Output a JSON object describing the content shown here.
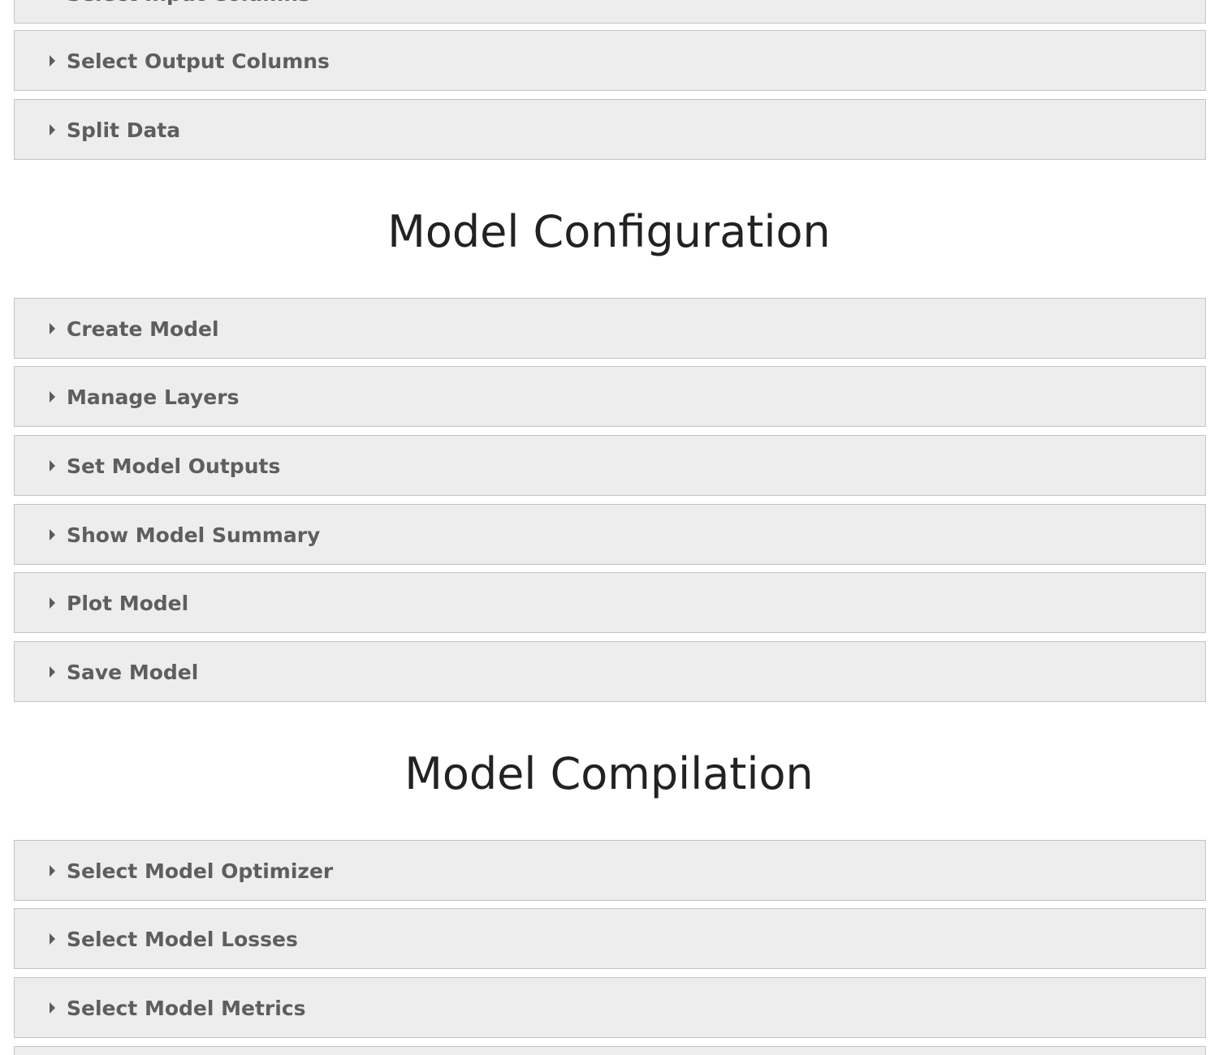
{
  "sections": {
    "data_prep": {
      "panels": [
        {
          "label": "Select Input Columns"
        },
        {
          "label": "Select Output Columns"
        },
        {
          "label": "Split Data"
        }
      ]
    },
    "model_configuration": {
      "title": "Model Configuration",
      "panels": [
        {
          "label": "Create Model"
        },
        {
          "label": "Manage Layers"
        },
        {
          "label": "Set Model Outputs"
        },
        {
          "label": "Show Model Summary"
        },
        {
          "label": "Plot Model"
        },
        {
          "label": "Save Model"
        }
      ]
    },
    "model_compilation": {
      "title": "Model Compilation",
      "panels": [
        {
          "label": "Select Model Optimizer"
        },
        {
          "label": "Select Model Losses"
        },
        {
          "label": "Select Model Metrics"
        },
        {
          "label": ""
        }
      ]
    }
  },
  "colors": {
    "panel_background": "#ededed",
    "panel_border": "#c4c4c4",
    "panel_text": "#5e5e5e",
    "heading_text": "#222222"
  },
  "icons": {
    "panel_toggle": "caret-right-icon"
  }
}
